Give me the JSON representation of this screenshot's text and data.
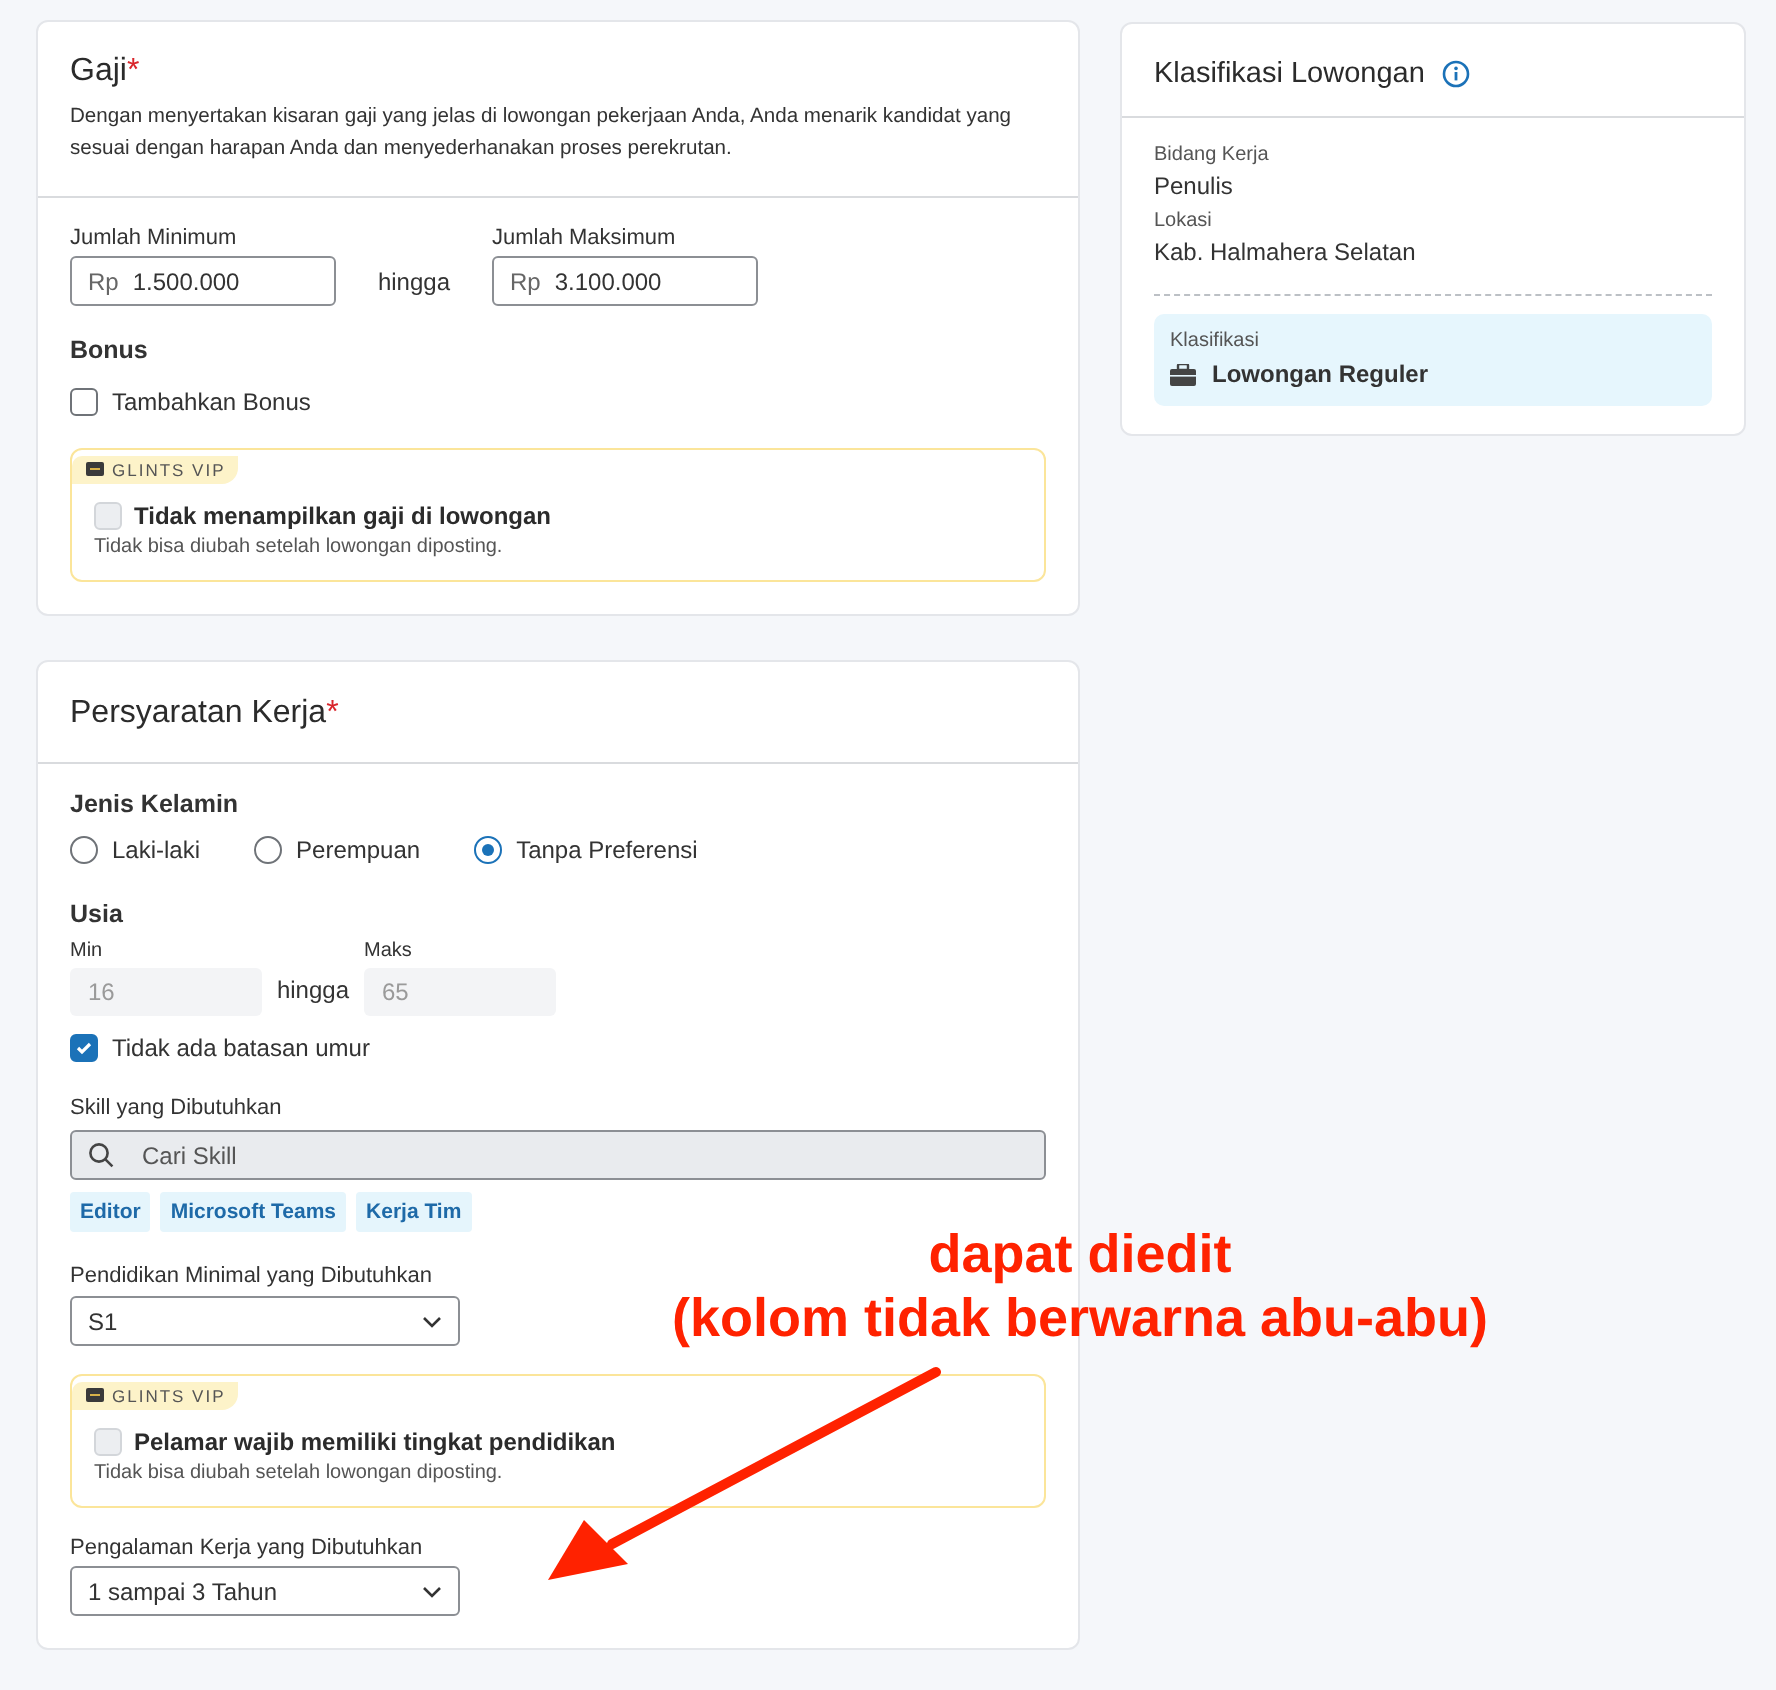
{
  "salary_card": {
    "title": "Gaji",
    "required_mark": "*",
    "description": "Dengan menyertakan kisaran gaji yang jelas di lowongan pekerjaan Anda, Anda menarik kandidat yang sesuai dengan harapan Anda dan menyederhanakan proses perekrutan.",
    "min": {
      "label": "Jumlah Minimum",
      "prefix": "Rp",
      "value": "1.500.000"
    },
    "separator": "hingga",
    "max": {
      "label": "Jumlah Maksimum",
      "prefix": "Rp",
      "value": "3.100.000"
    },
    "bonus": {
      "heading": "Bonus",
      "label": "Tambahkan Bonus",
      "checked": false
    },
    "vip": {
      "badge": "GLINTS VIP",
      "label": "Tidak menampilkan gaji di lowongan",
      "checked": false,
      "disabled": true,
      "note": "Tidak bisa diubah setelah lowongan diposting."
    }
  },
  "requirements_card": {
    "title": "Persyaratan Kerja",
    "required_mark": "*",
    "gender": {
      "heading": "Jenis Kelamin",
      "options": [
        {
          "label": "Laki-laki",
          "selected": false
        },
        {
          "label": "Perempuan",
          "selected": false
        },
        {
          "label": "Tanpa Preferensi",
          "selected": true
        }
      ]
    },
    "age": {
      "heading": "Usia",
      "min": {
        "label": "Min",
        "value": "16",
        "disabled": true
      },
      "separator": "hingga",
      "max": {
        "label": "Maks",
        "value": "65",
        "disabled": true
      },
      "no_limit": {
        "label": "Tidak ada batasan umur",
        "checked": true
      }
    },
    "skills": {
      "label": "Skill yang Dibutuhkan",
      "placeholder": "Cari Skill",
      "disabled": true,
      "tags": [
        "Editor",
        "Microsoft Teams",
        "Kerja Tim"
      ]
    },
    "education": {
      "label": "Pendidikan Minimal yang Dibutuhkan",
      "value": "S1"
    },
    "vip": {
      "badge": "GLINTS VIP",
      "label": "Pelamar wajib memiliki tingkat pendidikan",
      "checked": false,
      "disabled": true,
      "note": "Tidak bisa diubah setelah lowongan diposting."
    },
    "experience": {
      "label": "Pengalaman Kerja yang Dibutuhkan",
      "value": "1 sampai 3 Tahun"
    }
  },
  "classification_card": {
    "title": "Klasifikasi Lowongan",
    "fields": [
      {
        "label": "Bidang Kerja",
        "value": "Penulis"
      },
      {
        "label": "Lokasi",
        "value": "Kab. Halmahera Selatan"
      }
    ],
    "classification": {
      "label": "Klasifikasi",
      "value": "Lowongan Reguler"
    }
  },
  "annotation": {
    "lines": [
      "dapat diedit",
      "(kolom tidak berwarna abu-abu)"
    ]
  }
}
